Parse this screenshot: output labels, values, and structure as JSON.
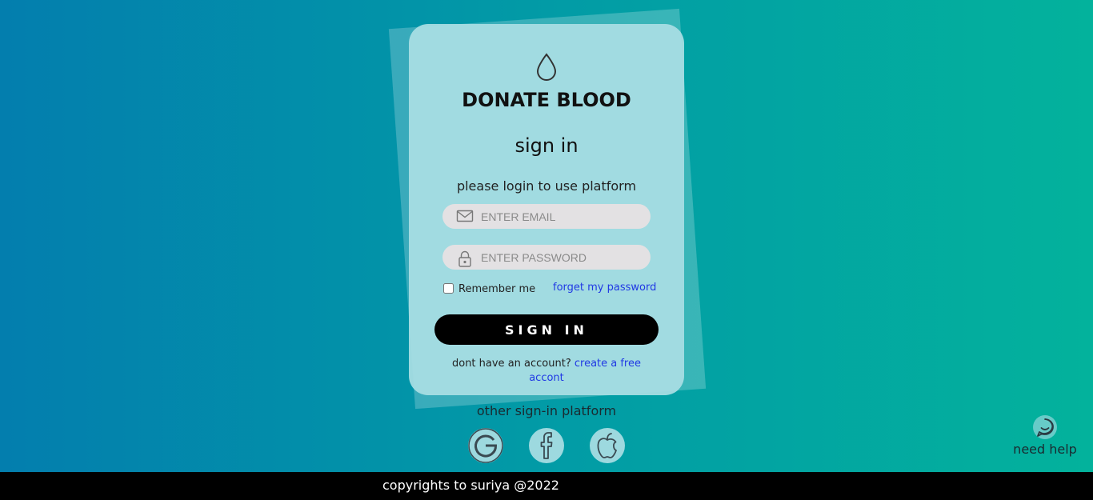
{
  "brand": {
    "logo_icon": "blood-drop-icon",
    "name": "DONATE BLOOD"
  },
  "form": {
    "title": "sign in",
    "subtitle": "please login to use platform",
    "email": {
      "icon": "envelope-icon",
      "placeholder": "ENTER EMAIL",
      "value": ""
    },
    "password": {
      "icon": "lock-icon",
      "placeholder": "ENTER PASSWORD",
      "value": ""
    },
    "remember_label": "Remember me",
    "remember_checked": false,
    "forgot_link": "forget my password",
    "submit_label": "SIGN IN",
    "signup_prompt": "dont have an account?",
    "signup_link": "create a free accont"
  },
  "social": {
    "heading": "other sign-in platform",
    "providers": [
      {
        "name": "Google",
        "icon": "google-icon"
      },
      {
        "name": "Facebook",
        "icon": "facebook-icon"
      },
      {
        "name": "Apple",
        "icon": "apple-icon"
      }
    ]
  },
  "help": {
    "icon": "chat-bubble-icon",
    "label": "need help"
  },
  "footer": {
    "text": "copyrights to suriya @2022"
  },
  "colors": {
    "gradient_start": "#037eae",
    "gradient_end": "#03b29c",
    "card": "#aadee4",
    "button": "#000000",
    "link": "#2139e4"
  }
}
